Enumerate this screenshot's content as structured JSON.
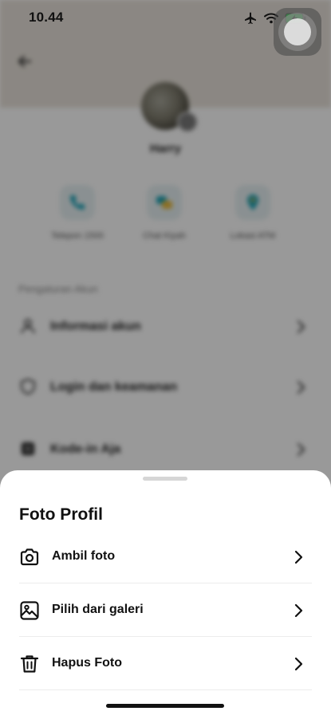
{
  "status_bar": {
    "time": "10.44"
  },
  "profile": {
    "name": "Harry",
    "quick_actions": [
      {
        "label": "Telepon 1500",
        "icon": "phone-icon"
      },
      {
        "label": "Chat Kiyah",
        "icon": "chat-icon"
      },
      {
        "label": "Lokasi ATM",
        "icon": "location-pin-icon"
      }
    ],
    "section_title": "Pengaturan Akun",
    "menu": [
      {
        "label": "Informasi akun",
        "icon": "user-icon"
      },
      {
        "label": "Login dan keamanan",
        "icon": "shield-icon"
      },
      {
        "label": "Kode-in Aja",
        "icon": "qr-icon"
      }
    ]
  },
  "sheet": {
    "title": "Foto Profil",
    "options": [
      {
        "label": "Ambil foto",
        "icon": "camera-icon"
      },
      {
        "label": "Pilih dari galeri",
        "icon": "gallery-icon"
      },
      {
        "label": "Hapus Foto",
        "icon": "trash-icon"
      }
    ]
  },
  "colors": {
    "accent": "#1aa3b8",
    "sheet_background": "#ffffff",
    "overlay": "rgba(0,0,0,0.40)"
  }
}
